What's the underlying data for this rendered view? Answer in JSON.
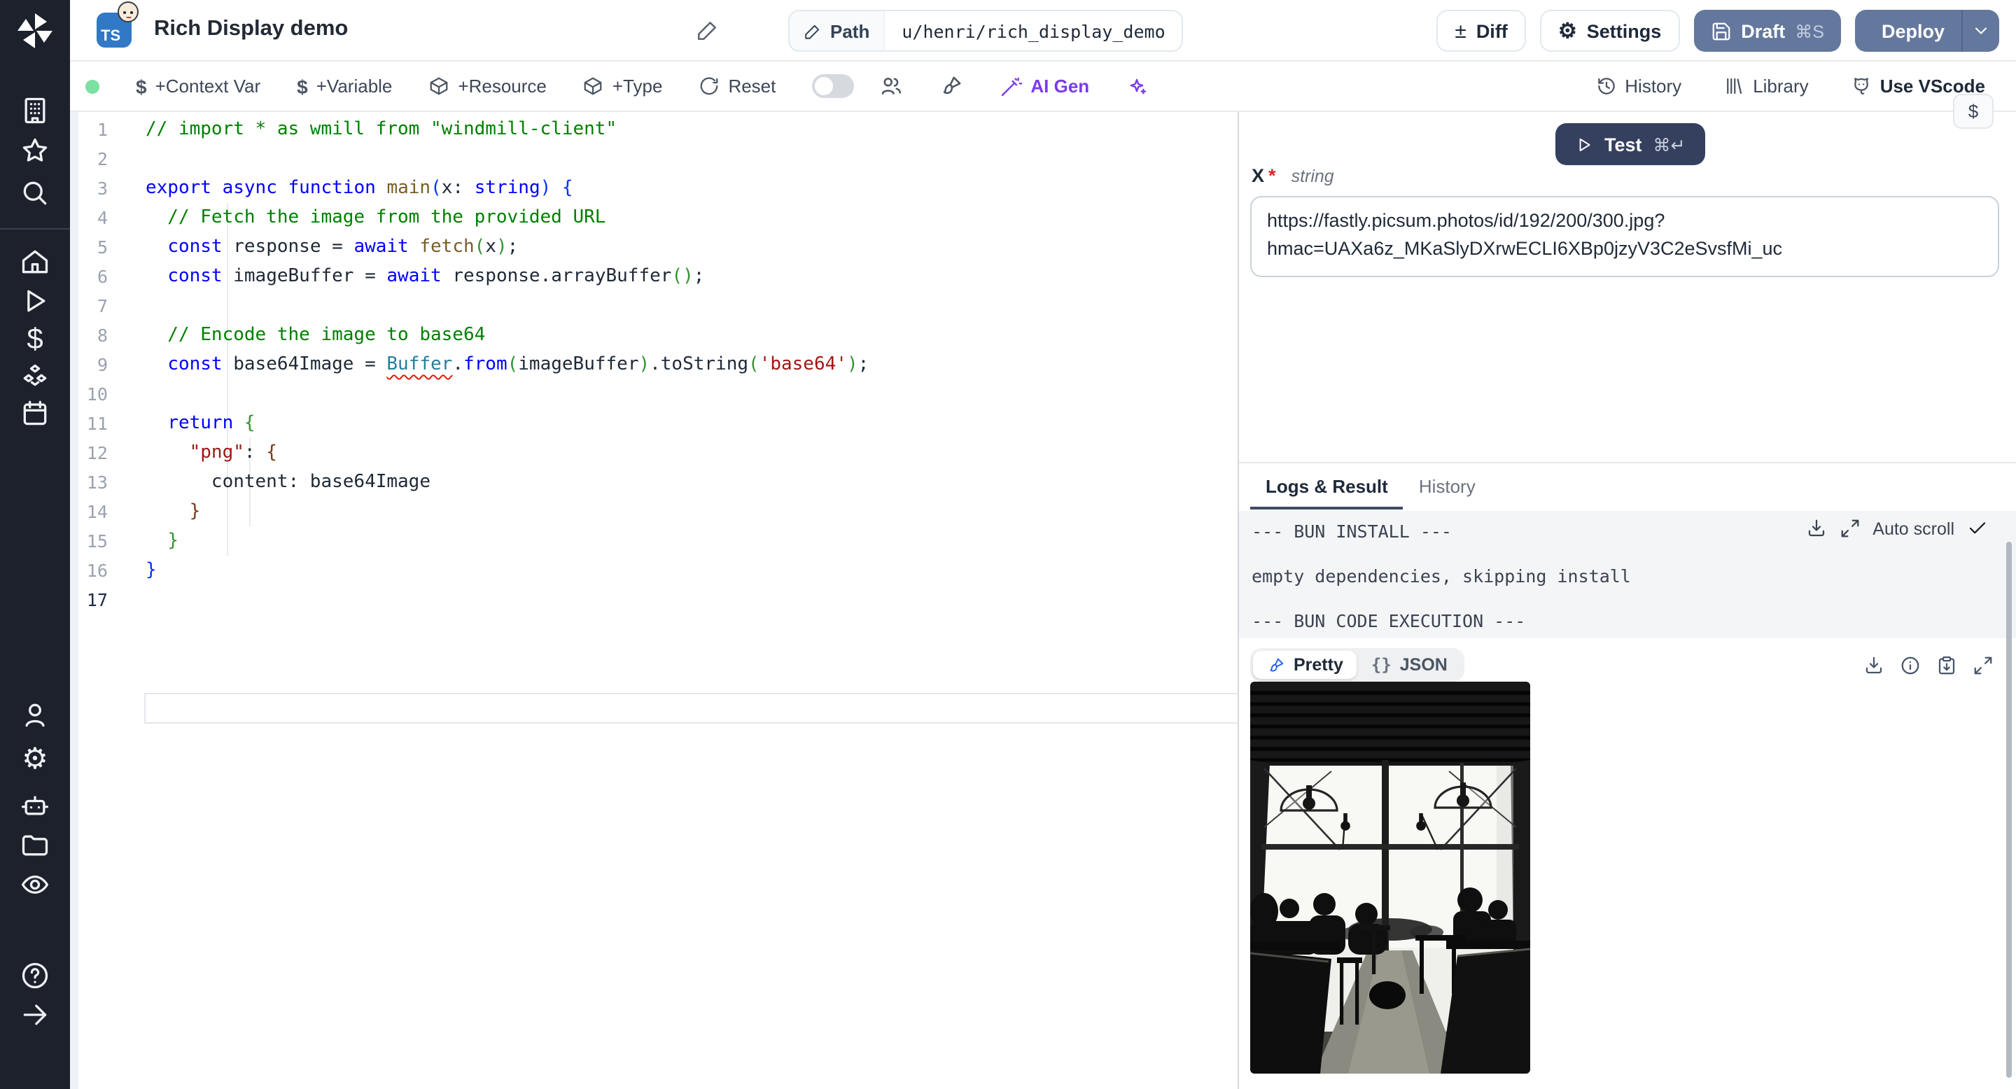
{
  "sidebar": {
    "items": [
      "workspace",
      "favorites",
      "search",
      "home",
      "runs",
      "variables",
      "resources",
      "schedules",
      "users",
      "settings",
      "workers",
      "folders",
      "audit-logs",
      "help",
      "expand-sidebar"
    ]
  },
  "header": {
    "badge": "TS",
    "title": "Rich Display demo",
    "path_label": "Path",
    "path_value": "u/henri/rich_display_demo",
    "diff_label": "Diff",
    "diff_sign": "±",
    "settings_label": "Settings",
    "settings_gear": "⚙",
    "draft_label": "Draft",
    "draft_kbd": "⌘S",
    "deploy_label": "Deploy"
  },
  "toolbar": {
    "dollar": "$",
    "context_var": "+Context Var",
    "variable": "+Variable",
    "resource": "+Resource",
    "type": "+Type",
    "reset": "Reset",
    "ai_gen": "AI Gen",
    "history": "History",
    "library": "Library",
    "vscode": "Use VScode"
  },
  "editor": {
    "active_line": 17,
    "lines": [
      [
        {
          "c": "comment",
          "t": "// import * as wmill from \"windmill-client\""
        }
      ],
      [],
      [
        {
          "c": "keyword",
          "t": "export"
        },
        {
          "c": "text",
          "t": " "
        },
        {
          "c": "keyword",
          "t": "async"
        },
        {
          "c": "text",
          "t": " "
        },
        {
          "c": "keyword",
          "t": "function"
        },
        {
          "c": "text",
          "t": " "
        },
        {
          "c": "func",
          "t": "main"
        },
        {
          "c": "b1",
          "t": "("
        },
        {
          "c": "text",
          "t": "x: "
        },
        {
          "c": "keyword",
          "t": "string"
        },
        {
          "c": "b1",
          "t": ")"
        },
        {
          "c": "text",
          "t": " "
        },
        {
          "c": "b1",
          "t": "{"
        }
      ],
      [
        {
          "c": "comment",
          "t": "  // Fetch the image from the provided URL"
        }
      ],
      [
        {
          "c": "text",
          "t": "  "
        },
        {
          "c": "keyword",
          "t": "const"
        },
        {
          "c": "text",
          "t": " response = "
        },
        {
          "c": "keyword",
          "t": "await"
        },
        {
          "c": "text",
          "t": " "
        },
        {
          "c": "func",
          "t": "fetch"
        },
        {
          "c": "b2",
          "t": "("
        },
        {
          "c": "text",
          "t": "x"
        },
        {
          "c": "b2",
          "t": ")"
        },
        {
          "c": "text",
          "t": ";"
        }
      ],
      [
        {
          "c": "text",
          "t": "  "
        },
        {
          "c": "keyword",
          "t": "const"
        },
        {
          "c": "text",
          "t": " imageBuffer = "
        },
        {
          "c": "keyword",
          "t": "await"
        },
        {
          "c": "text",
          "t": " response.arrayBuffer"
        },
        {
          "c": "b2",
          "t": "()"
        },
        {
          "c": "text",
          "t": ";"
        }
      ],
      [],
      [
        {
          "c": "comment",
          "t": "  // Encode the image to base64"
        }
      ],
      [
        {
          "c": "text",
          "t": "  "
        },
        {
          "c": "keyword",
          "t": "const"
        },
        {
          "c": "text",
          "t": " base64Image = "
        },
        {
          "c": "type",
          "t": "Buffer",
          "u": true
        },
        {
          "c": "text",
          "t": "."
        },
        {
          "c": "keyword",
          "t": "from"
        },
        {
          "c": "b2",
          "t": "("
        },
        {
          "c": "text",
          "t": "imageBuffer"
        },
        {
          "c": "b2",
          "t": ")"
        },
        {
          "c": "text",
          "t": ".toString"
        },
        {
          "c": "b2",
          "t": "("
        },
        {
          "c": "string",
          "t": "'base64'"
        },
        {
          "c": "b2",
          "t": ")"
        },
        {
          "c": "text",
          "t": ";"
        }
      ],
      [],
      [
        {
          "c": "text",
          "t": "  "
        },
        {
          "c": "keyword",
          "t": "return"
        },
        {
          "c": "text",
          "t": " "
        },
        {
          "c": "b2",
          "t": "{"
        }
      ],
      [
        {
          "c": "text",
          "t": "    "
        },
        {
          "c": "string",
          "t": "\"png\""
        },
        {
          "c": "text",
          "t": ": "
        },
        {
          "c": "b3",
          "t": "{"
        }
      ],
      [
        {
          "c": "text",
          "t": "      content: base64Image"
        }
      ],
      [
        {
          "c": "text",
          "t": "    "
        },
        {
          "c": "b3",
          "t": "}"
        }
      ],
      [
        {
          "c": "text",
          "t": "  "
        },
        {
          "c": "b2",
          "t": "}"
        }
      ],
      [
        {
          "c": "b1",
          "t": "}"
        }
      ],
      []
    ]
  },
  "runner": {
    "test_label": "Test",
    "test_kbd": "⌘↵",
    "arg_name": "x",
    "arg_required": "*",
    "arg_type": "string",
    "arg_value": "https://fastly.picsum.photos/id/192/200/300.jpg?hmac=UAXa6z_MKaSlyDXrwECLI6XBp0jzyV3C2eSvsfMi_uc",
    "dollar_chip": "$"
  },
  "tabs": {
    "logs": "Logs & Result",
    "history": "History"
  },
  "logs": {
    "lines": [
      "--- BUN INSTALL ---",
      "",
      "empty dependencies, skipping install",
      "",
      "--- BUN CODE EXECUTION ---"
    ],
    "auto_scroll": "Auto scroll"
  },
  "result": {
    "pretty": "Pretty",
    "json_braces": "{}",
    "json": "JSON"
  },
  "colors": {
    "sidebar_bg": "#1c212c",
    "accent_slate_button": "#64789e",
    "test_button": "#353f5e",
    "ts_badge_blue": "#3178c6",
    "ai_purple": "#7c3aed",
    "status_green_dot": "#7ce0a3",
    "error_marker": "#ee6c5f",
    "log_bg": "#f4f5f6"
  }
}
